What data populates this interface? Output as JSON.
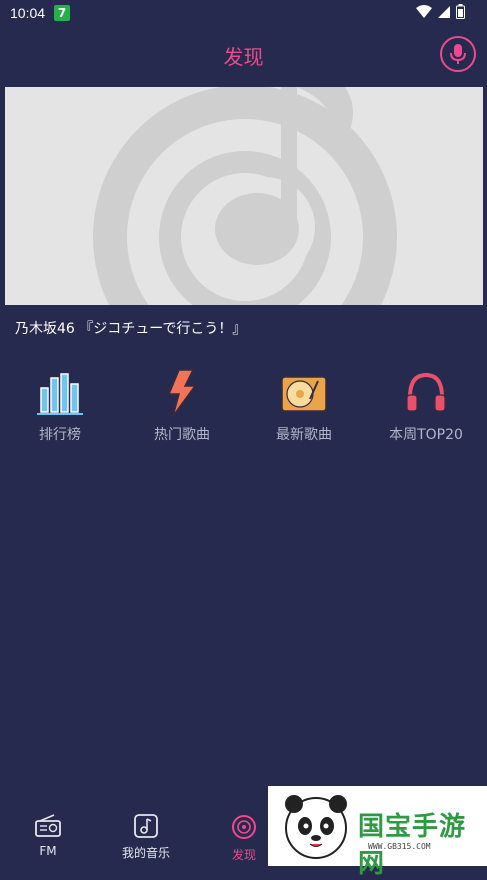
{
  "status_bar": {
    "time": "10:04",
    "app_badge": "7"
  },
  "header": {
    "title": "发现"
  },
  "banner": {
    "caption": "乃木坂46 『ジコチューで行こう！』"
  },
  "categories": [
    {
      "label": "排行榜",
      "icon": "bar-chart-icon"
    },
    {
      "label": "热门歌曲",
      "icon": "lightning-icon"
    },
    {
      "label": "最新歌曲",
      "icon": "record-player-icon"
    },
    {
      "label": "本周TOP20",
      "icon": "headphones-icon"
    }
  ],
  "bottom_nav": {
    "items": [
      {
        "label": "FM",
        "icon": "radio-icon"
      },
      {
        "label": "我的音乐",
        "icon": "music-note-icon"
      },
      {
        "label": "发现",
        "icon": "disc-icon",
        "active": true
      }
    ]
  },
  "watermark": {
    "text": "国宝手游网",
    "url": "WWW.GB315.COM"
  },
  "colors": {
    "background": "#262a4e",
    "accent": "#ec4a8c",
    "muted_text": "#b3b6c9"
  }
}
